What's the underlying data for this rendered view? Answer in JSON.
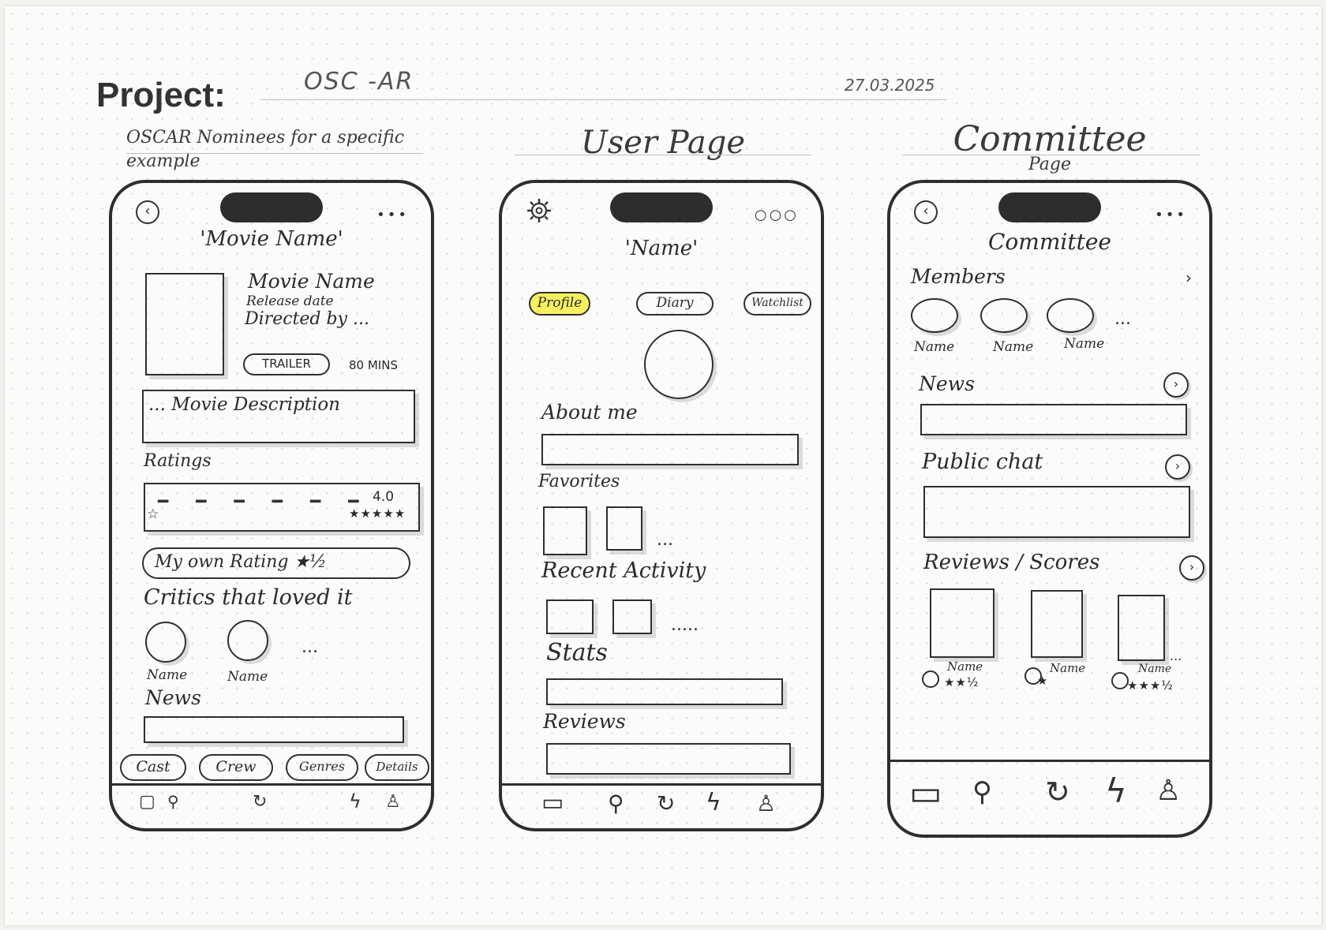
{
  "header": {
    "project_label": "Project:",
    "project_name": "OSC -AR",
    "date": "27.03.2025"
  },
  "screens": {
    "movie": {
      "title": "OSCAR Nominees for a specific example",
      "screen_title": "'Movie Name'",
      "info": {
        "movie_name": "Movie Name",
        "release_date": "Release date",
        "directed_by": "Directed by ...",
        "trailer": "TRAILER",
        "duration": "80 MINS"
      },
      "description": "... Movie Description",
      "ratings_label": "Ratings",
      "rating_value": "4.0",
      "rating_stars": "★★★★★",
      "own_rating": "My own Rating ★½",
      "critics_label": "Critics that loved it",
      "critics": [
        "Name",
        "Name"
      ],
      "more": "...",
      "news_label": "News",
      "tabs": [
        "Cast",
        "Crew",
        "Genres",
        "Details"
      ]
    },
    "user": {
      "title": "User Page",
      "screen_title": "'Name'",
      "tabs": [
        "Profile",
        "Diary",
        "Watchlist"
      ],
      "about_label": "About me",
      "favorites_label": "Favorites",
      "recent_label": "Recent Activity",
      "stats_label": "Stats",
      "reviews_label": "Reviews",
      "more": "...",
      "more_long": "....."
    },
    "committee": {
      "title": "Committee",
      "title_sub": "Page",
      "screen_title": "Committee",
      "members_label": "Members",
      "members": [
        "Name",
        "Name",
        "Name"
      ],
      "more": "...",
      "news_label": "News",
      "chat_label": "Public chat",
      "reviews_label": "Reviews / Scores",
      "reviews": [
        {
          "name": "Name",
          "stars": "★★½"
        },
        {
          "name": "Name",
          "stars": "★"
        },
        {
          "name": "Name",
          "stars": "★★★½"
        }
      ]
    }
  },
  "icons": [
    "back-icon",
    "gear-icon",
    "more-dots-icon",
    "home-icon",
    "search-icon",
    "refresh-icon",
    "lightning-icon",
    "profile-icon",
    "chevron-right-icon"
  ]
}
